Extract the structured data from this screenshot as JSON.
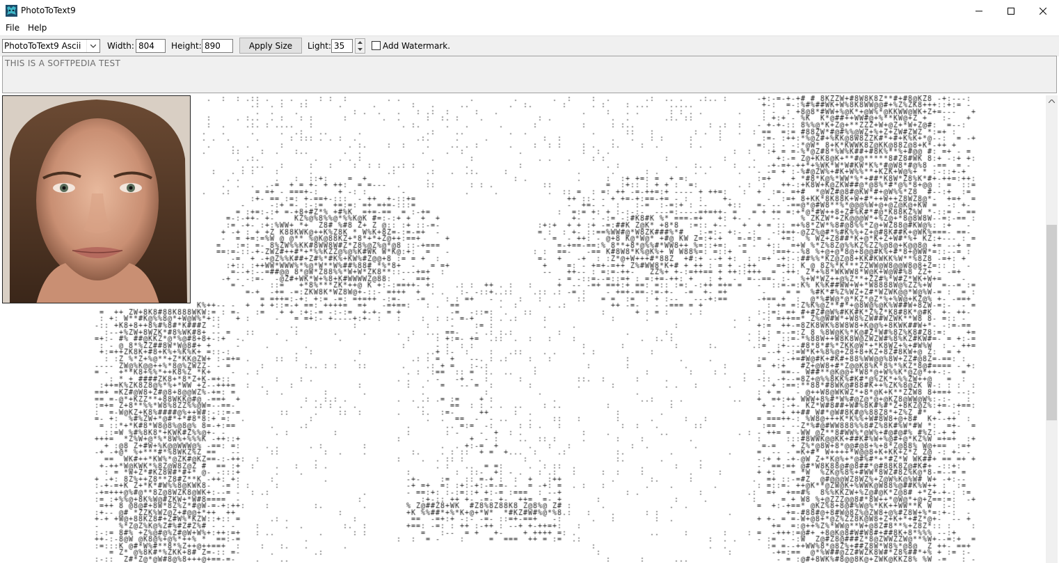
{
  "window": {
    "title": "PhotoToText9",
    "minimize_icon": "minimize-icon",
    "maximize_icon": "maximize-icon",
    "close_icon": "close-icon"
  },
  "menu": {
    "items": [
      "File",
      "Help"
    ]
  },
  "toolbar": {
    "mode_select_value": "PhotoToText9 Ascii",
    "width_label": "Width:",
    "width_value": "804",
    "height_label": "Height:",
    "height_value": "890",
    "apply_label": "Apply Size",
    "light_label": "Light:",
    "light_value": "35",
    "watermark_label": "Add Watermark.",
    "watermark_checked": false
  },
  "text_input": {
    "value": "THIS IS A SOFTPEDIA TEST"
  },
  "colors": {
    "toolbar_bg": "#f0f0f0",
    "ascii_ink": "#1a1a1a",
    "placeholder": "#6d6d6d"
  }
}
